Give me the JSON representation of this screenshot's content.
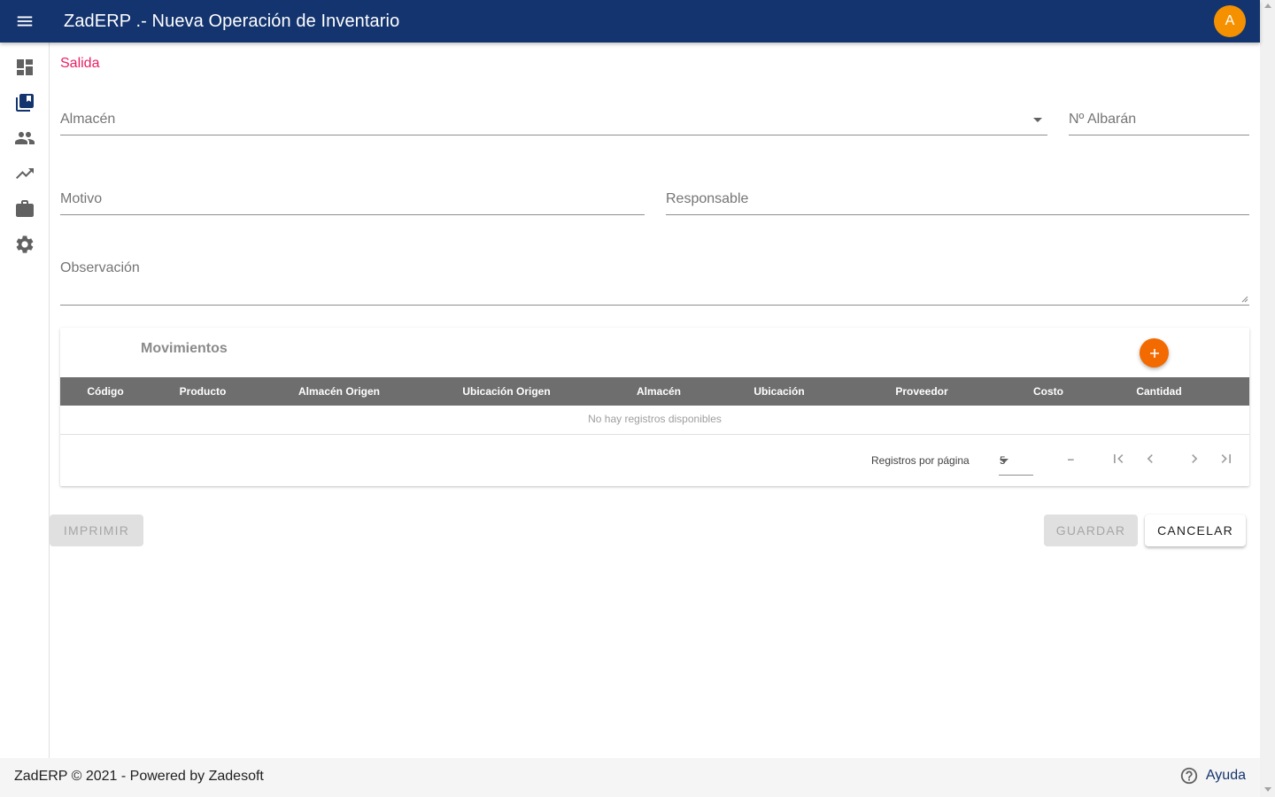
{
  "header": {
    "title": "ZadERP .- Nueva Operación de Inventario",
    "avatar_initial": "A"
  },
  "sidebar": {
    "items": [
      {
        "icon": "dashboard-icon"
      },
      {
        "icon": "library-books-icon"
      },
      {
        "icon": "people-icon"
      },
      {
        "icon": "trending-up-icon"
      },
      {
        "icon": "briefcase-icon"
      },
      {
        "icon": "settings-icon"
      }
    ]
  },
  "form": {
    "section_label": "Salida",
    "almacen_label": "Almacén",
    "albaran_label": "Nº Albarán",
    "motivo_label": "Motivo",
    "responsable_label": "Responsable",
    "observacion_label": "Observación"
  },
  "movements": {
    "title": "Movimientos",
    "columns": [
      "Código",
      "Producto",
      "Almacén Origen",
      "Ubicación Origen",
      "Almacén",
      "Ubicación",
      "Proveedor",
      "Costo",
      "Cantidad"
    ],
    "empty_text": "No hay registros disponibles",
    "per_page_label": "Registros por página",
    "per_page_value": "5",
    "range_text": "–"
  },
  "actions": {
    "print_label": "Imprimir",
    "save_label": "Guardar",
    "cancel_label": "Cancelar"
  },
  "footer": {
    "copyright": "ZadERP © 2021 - Powered by Zadesoft",
    "help_label": "Ayuda"
  },
  "colors": {
    "header_bg": "#13346e",
    "accent_pink": "#e91e63",
    "fab_orange": "#f26a00",
    "avatar_orange": "#f59100",
    "table_header_bg": "#6e6e6e"
  }
}
